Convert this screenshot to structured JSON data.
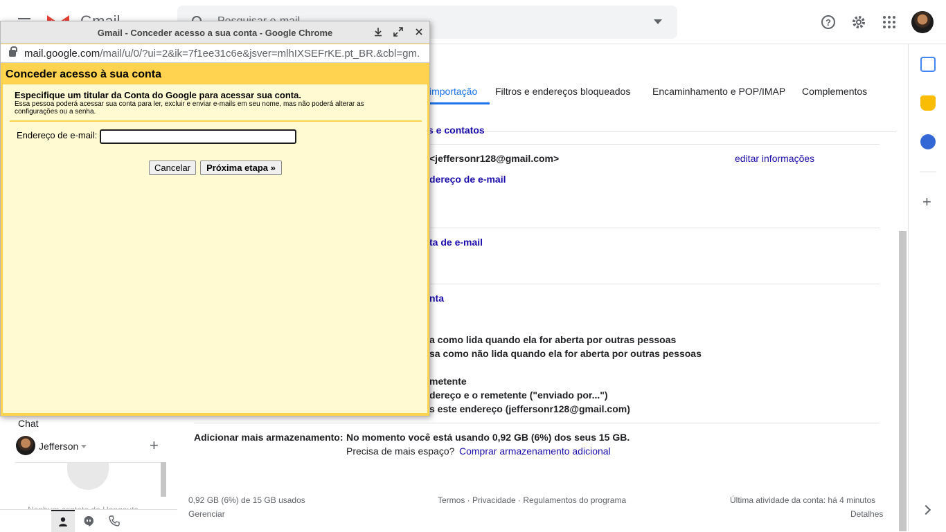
{
  "header": {
    "app_name": "Gmail",
    "search_placeholder": "Pesquisar e-mail"
  },
  "tabs": [
    {
      "label": "importação",
      "active": true
    },
    {
      "label": "Filtros e endereços bloqueados",
      "active": false
    },
    {
      "label": "Encaminhamento e POP/IMAP",
      "active": false
    },
    {
      "label": "Complementos",
      "active": false
    }
  ],
  "settings": {
    "partial_heading_top": "s e contatos",
    "account_email": "<jeffersonr128@gmail.com>",
    "edit_info_link": "editar informações",
    "add_email_link_partial": "dereço de e-mail",
    "add_account_link_partial": "ta de e-mail",
    "grant_access_link_partial": "nta",
    "read_option_1": "a como lida quando ela for aberta por outras pessoas",
    "read_option_2": "sa como não lida quando ela for aberta por outras pessoas",
    "sender_option_1": "metente",
    "sender_option_2": "dereço e o remetente (\"enviado por...\")",
    "sender_option_3": "s este endereço (jeffersonr128@gmail.com)",
    "storage_label": "Adicionar mais armazenamento:",
    "storage_usage": "No momento você está usando 0,92 GB (6%) dos seus 15 GB.",
    "storage_question": "Precisa de mais espaço?",
    "storage_link": "Comprar armazenamento adicional"
  },
  "footer": {
    "usage": "0,92 GB (6%) de 15 GB usados",
    "manage": "Gerenciar",
    "links": "Termos · Privacidade · Regulamentos do programa",
    "last_activity": "Última atividade da conta: há 4 minutos",
    "details": "Detalhes"
  },
  "chat": {
    "title": "Chat",
    "user_name": "Jefferson",
    "faded_text": "Nenhum contato do Hangouts"
  },
  "popup": {
    "window_title": "Gmail - Conceder acesso a sua conta - Google Chrome",
    "url_host": "mail.google.com",
    "url_path": "/mail/u/0/?ui=2&ik=7f1ee31c6e&jsver=mlhIXSEFrKE.pt_BR.&cbl=gm...",
    "heading": "Conceder acesso à sua conta",
    "subheading": "Especifique um titular da Conta do Google para acessar sua conta.",
    "description": "Essa pessoa poderá acessar sua conta para ler, excluir e enviar e-mails em seu nome, mas não poderá alterar as configurações ou a senha.",
    "email_label": "Endereço de e-mail:",
    "email_value": "",
    "cancel_label": "Cancelar",
    "next_label": "Próxima etapa »"
  },
  "colors": {
    "popup_background": "#ffd34f",
    "popup_inner": "#fffad1",
    "link": "#1a0dab",
    "accent": "#1a73e8"
  }
}
